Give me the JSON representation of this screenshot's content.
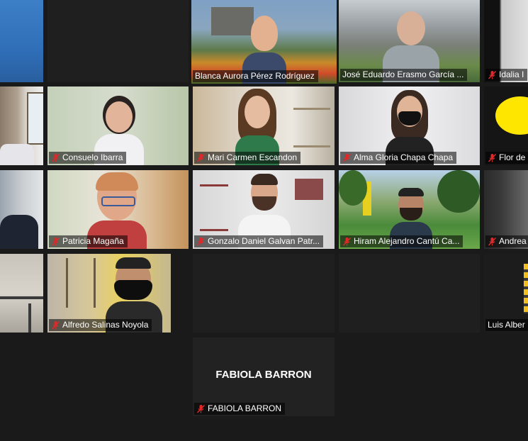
{
  "meeting": {
    "participants": [
      {
        "id": "p1",
        "name": "",
        "muted": false
      },
      {
        "id": "p2",
        "name": "",
        "muted": false
      },
      {
        "id": "p3",
        "name": "Blanca Aurora Pérez Rodríguez",
        "muted": false,
        "active_speaker": true
      },
      {
        "id": "p4",
        "name": "José Eduardo Erasmo García ...",
        "muted": false
      },
      {
        "id": "p5",
        "name": "Idalia I",
        "muted": true
      },
      {
        "id": "p6",
        "name": "",
        "muted": false
      },
      {
        "id": "p7",
        "name": "Consuelo Ibarra",
        "muted": true
      },
      {
        "id": "p8",
        "name": "Mari Carmen Escandon",
        "muted": true
      },
      {
        "id": "p9",
        "name": "Alma Gloria Chapa  Chapa",
        "muted": true
      },
      {
        "id": "p10",
        "name": "Flor de",
        "muted": true
      },
      {
        "id": "p11",
        "name": "",
        "muted": false
      },
      {
        "id": "p12",
        "name": "Patricia Magaña",
        "muted": true
      },
      {
        "id": "p13",
        "name": "Gonzalo Daniel Galvan Patr...",
        "muted": true
      },
      {
        "id": "p14",
        "name": "Hiram Alejandro Cantú Ca...",
        "muted": true
      },
      {
        "id": "p15",
        "name": "Andrea",
        "muted": true
      },
      {
        "id": "p16",
        "name": "",
        "muted": false
      },
      {
        "id": "p17",
        "name": "Alfredo Salinas Noyola",
        "muted": true
      },
      {
        "id": "p18",
        "name": "Luis Alber",
        "muted": false
      },
      {
        "id": "p19",
        "name": "FABIOLA BARRON",
        "muted": true,
        "avatar_text": "FABIOLA BARRON"
      }
    ]
  },
  "colors": {
    "background": "#1a1a1a",
    "tile": "#232323",
    "active_border": "#c6e07a",
    "mute_red": "#e02828"
  }
}
